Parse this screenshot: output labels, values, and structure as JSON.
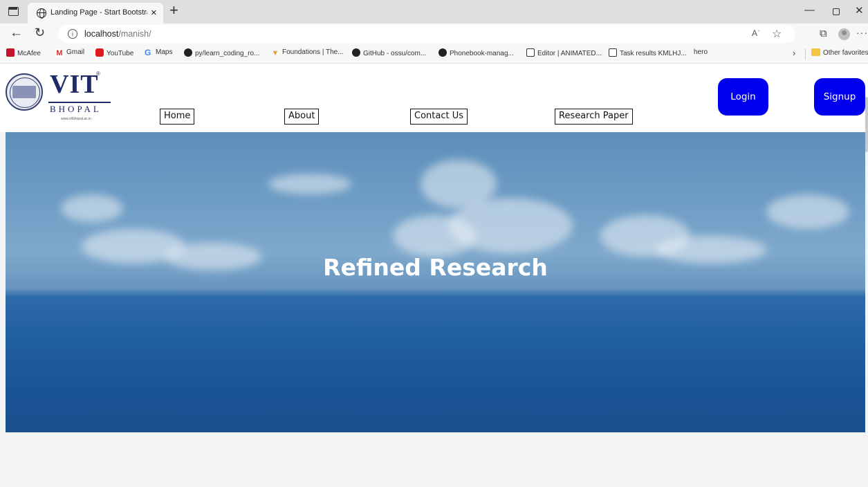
{
  "browser": {
    "tab_title": "Landing Page - Start Bootstrap T",
    "url_host": "localhost",
    "url_path": "/manish/",
    "read_aloud_label": "Aʾ",
    "bookmarks": [
      {
        "label": "McAfee",
        "icon": "mcafee-icon"
      },
      {
        "label": "Gmail",
        "icon": "gmail-icon"
      },
      {
        "label": "YouTube",
        "icon": "youtube-icon"
      },
      {
        "label": "Maps",
        "icon": "google-icon"
      },
      {
        "label": "py/learn_coding_ro...",
        "icon": "github-icon"
      },
      {
        "label": "Foundations | The...",
        "icon": "foundations-icon"
      },
      {
        "label": "GitHub - ossu/com...",
        "icon": "github-icon"
      },
      {
        "label": "Phonebook-manag...",
        "icon": "github-icon"
      },
      {
        "label": "Editor | ANIMATED...",
        "icon": "document-icon"
      },
      {
        "label": "Task results KMLHJ...",
        "icon": "document-icon"
      },
      {
        "label": "hero",
        "icon": "hero-icon"
      }
    ],
    "other_favorites": "Other favorites"
  },
  "site": {
    "logo": {
      "name": "VIT",
      "city": "BHOPAL",
      "reg_mark": "®",
      "website": "www.vitbhopal.ac.in"
    },
    "nav": {
      "home": "Home",
      "about": "About",
      "contact": "Contact Us",
      "research": "Research Paper"
    },
    "login": "Login",
    "signup": "Signup",
    "hero_title": "Refined Research"
  },
  "colors": {
    "primary_button": "#0000ee",
    "nav_text": "#111111",
    "hero_text": "#ffffff"
  }
}
